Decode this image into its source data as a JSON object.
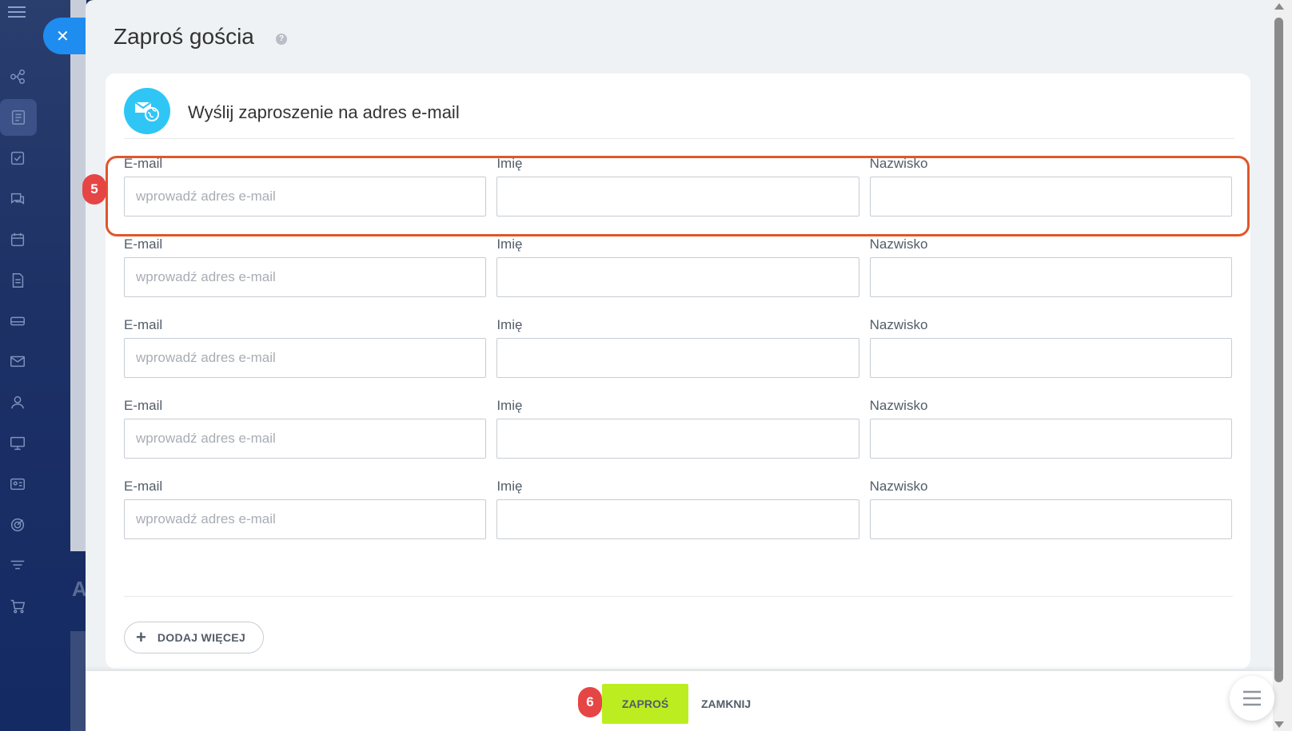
{
  "panel": {
    "title": "Zaproś gościa",
    "help_glyph": "?"
  },
  "card": {
    "title": "Wyślij zaproszenie na adres e-mail"
  },
  "form": {
    "rows": [
      {
        "email_label": "E-mail",
        "email_placeholder": "wprowadź adres e-mail",
        "first_label": "Imię",
        "last_label": "Nazwisko"
      },
      {
        "email_label": "E-mail",
        "email_placeholder": "wprowadź adres e-mail",
        "first_label": "Imię",
        "last_label": "Nazwisko"
      },
      {
        "email_label": "E-mail",
        "email_placeholder": "wprowadź adres e-mail",
        "first_label": "Imię",
        "last_label": "Nazwisko"
      },
      {
        "email_label": "E-mail",
        "email_placeholder": "wprowadź adres e-mail",
        "first_label": "Imię",
        "last_label": "Nazwisko"
      },
      {
        "email_label": "E-mail",
        "email_placeholder": "wprowadź adres e-mail",
        "first_label": "Imię",
        "last_label": "Nazwisko"
      }
    ],
    "add_more_icon": "+",
    "add_more_label": "DODAJ WIĘCEJ"
  },
  "footer": {
    "invite_label": "ZAPROŚ",
    "close_label": "ZAMKNIJ"
  },
  "annotations": {
    "step_5": "5",
    "step_6": "6",
    "highlight_color": "#e0562a",
    "badge_color": "#e64545"
  },
  "close_button": {
    "glyph": "✕"
  },
  "colors": {
    "accent_blue": "#1f8cf0",
    "invite_green": "#bbed21",
    "header_icon": "#2fc6f6"
  }
}
